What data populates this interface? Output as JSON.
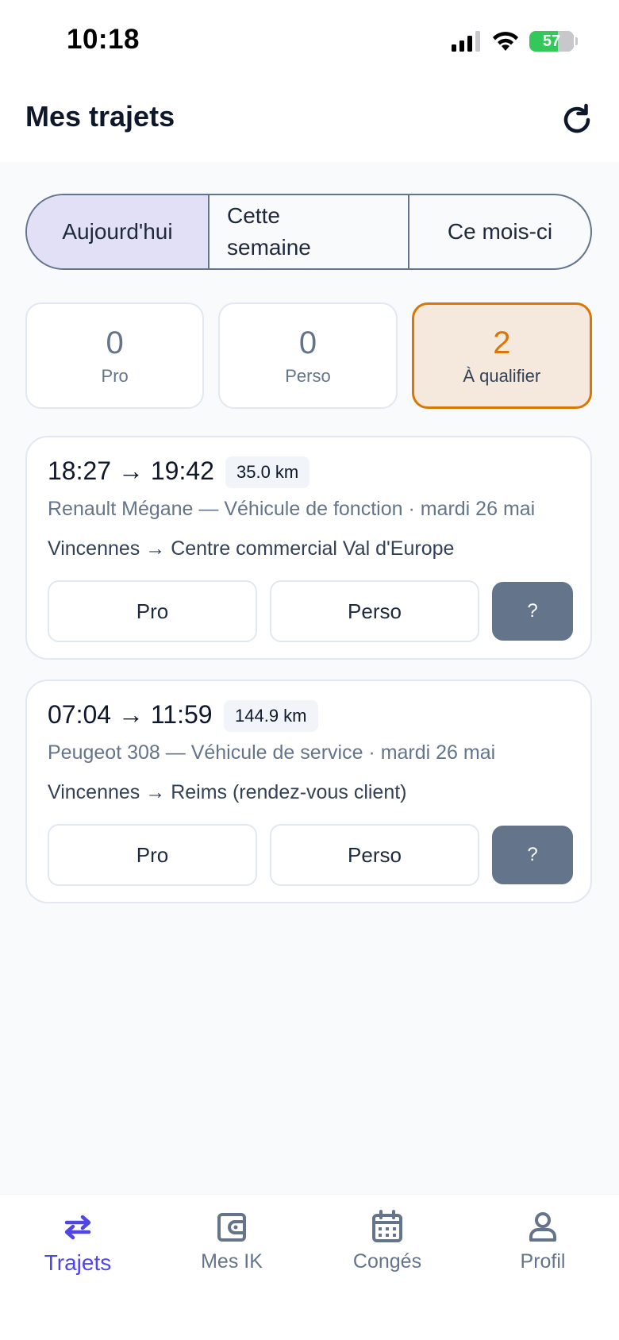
{
  "status_bar": {
    "time": "10:18",
    "battery": "57"
  },
  "header": {
    "title": "Mes trajets"
  },
  "period_tabs": [
    {
      "label": "Aujourd'hui",
      "active": true
    },
    {
      "label_line1": "Cette",
      "label_line2": "semaine",
      "active": false
    },
    {
      "label": "Ce mois-ci",
      "active": false
    }
  ],
  "stats": [
    {
      "value": "0",
      "label": "Pro"
    },
    {
      "value": "0",
      "label": "Perso"
    },
    {
      "value": "2",
      "label": "À qualifier"
    }
  ],
  "trips": [
    {
      "time": "18:27 → 19:42",
      "distance": "35.0 km",
      "meta": "Renault Mégane — Véhicule de fonction · mardi 26 mai",
      "route": "Vincennes → Centre commercial Val d'Europe",
      "btn_pro": "Pro",
      "btn_perso": "Perso",
      "btn_unknown": "?"
    },
    {
      "time": "07:04 → 11:59",
      "distance": "144.9 km",
      "meta": "Peugeot 308 — Véhicule de service · mardi 26 mai",
      "route": "Vincennes → Reims (rendez-vous client)",
      "btn_pro": "Pro",
      "btn_perso": "Perso",
      "btn_unknown": "?"
    }
  ],
  "tabbar": [
    {
      "label": "Trajets",
      "icon": "swap-arrows-icon",
      "active": true
    },
    {
      "label": "Mes IK",
      "icon": "wallet-icon",
      "active": false
    },
    {
      "label": "Congés",
      "icon": "calendar-icon",
      "active": false
    },
    {
      "label": "Profil",
      "icon": "person-icon",
      "active": false
    }
  ],
  "colors": {
    "accent": "#4f46e5",
    "active_segment": "#e2e0f7",
    "warning": "#d97706",
    "warning_bg": "#f5e9dd",
    "muted": "#64748b"
  }
}
